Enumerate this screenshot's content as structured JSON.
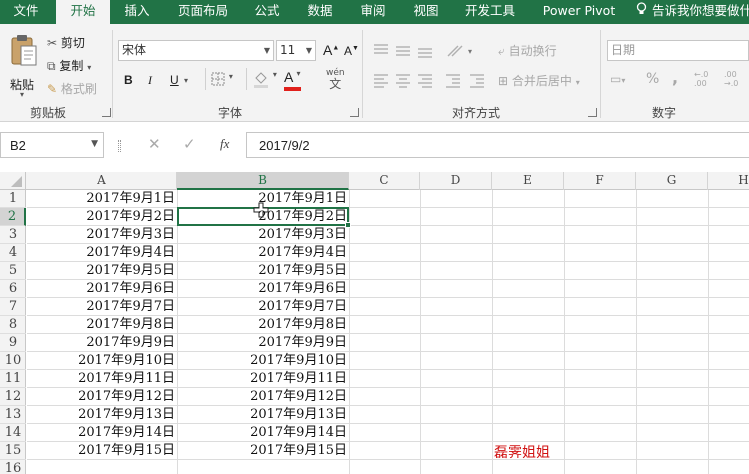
{
  "ribbon_tabs": [
    "文件",
    "开始",
    "插入",
    "页面布局",
    "公式",
    "数据",
    "审阅",
    "视图",
    "开发工具",
    "Power Pivot",
    "告诉我你想要做什么"
  ],
  "clipboard": {
    "paste": "粘贴",
    "cut": "剪切",
    "copy": "复制",
    "format_painter": "格式刷",
    "label": "剪贴板"
  },
  "font": {
    "name": "宋体",
    "size": "11",
    "grow": "A",
    "shrink": "A",
    "bold": "B",
    "italic": "I",
    "underline": "U",
    "color_letter": "A",
    "phonetic": "wén",
    "phonetic2": "文",
    "label": "字体"
  },
  "alignment": {
    "wrap_text": "自动换行",
    "merge_center": "合并后居中",
    "label": "对齐方式"
  },
  "number": {
    "format": "日期",
    "percent": "%",
    "comma": ",",
    "label": "数字"
  },
  "colors": {
    "accent": "#217346",
    "font_color_bar": "#e0201b",
    "note": "#d01010"
  },
  "formula_bar": {
    "name_box": "B2",
    "cancel": "✕",
    "enter": "✓",
    "fx": "fx",
    "value": "2017/9/2"
  },
  "columns": [
    "A",
    "B",
    "C",
    "D",
    "E",
    "F",
    "G",
    "H"
  ],
  "rows": [
    "1",
    "2",
    "3",
    "4",
    "5",
    "6",
    "7",
    "8",
    "9",
    "10",
    "11",
    "12",
    "13",
    "14",
    "15",
    "16"
  ],
  "cells": {
    "A": [
      "2017年9月1日",
      "2017年9月2日",
      "2017年9月3日",
      "2017年9月4日",
      "2017年9月5日",
      "2017年9月6日",
      "2017年9月7日",
      "2017年9月8日",
      "2017年9月9日",
      "2017年9月10日",
      "2017年9月11日",
      "2017年9月12日",
      "2017年9月13日",
      "2017年9月14日",
      "2017年9月15日"
    ],
    "B": [
      "2017年9月1日",
      "2017年9月2日",
      "2017年9月3日",
      "2017年9月4日",
      "2017年9月5日",
      "2017年9月6日",
      "2017年9月7日",
      "2017年9月8日",
      "2017年9月9日",
      "2017年9月10日",
      "2017年9月11日",
      "2017年9月12日",
      "2017年9月13日",
      "2017年9月14日",
      "2017年9月15日"
    ]
  },
  "active_cell": "B2",
  "note": "磊霁姐姐"
}
